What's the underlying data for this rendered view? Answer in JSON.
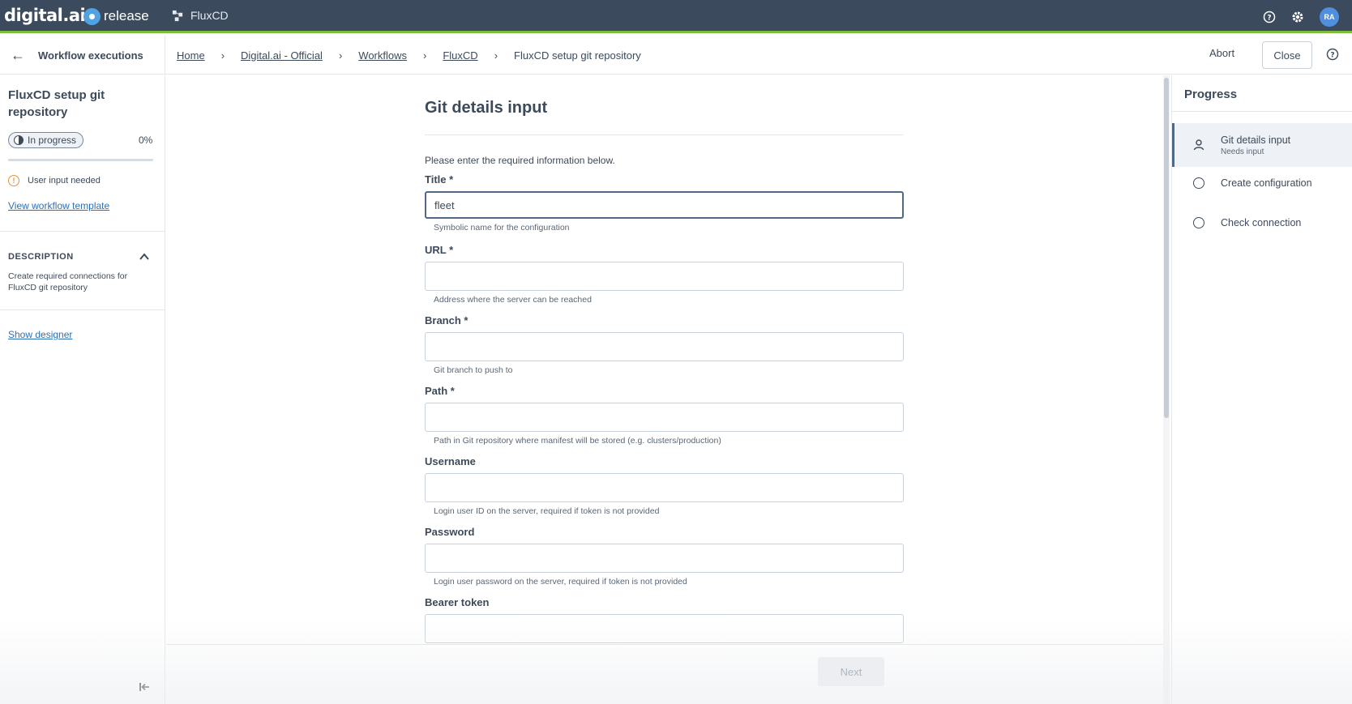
{
  "topbar": {
    "brand": "digital.ai",
    "product": "release",
    "app_name": "FluxCD",
    "avatar_initials": "RA",
    "colors": {
      "bar": "#3b4a5c",
      "accent_line": "#7ebd3a",
      "avatar": "#4f8fde"
    }
  },
  "nav": {
    "back_label": "Workflow executions",
    "breadcrumbs": [
      "Home",
      "Digital.ai - Official",
      "Workflows",
      "FluxCD"
    ],
    "current": "FluxCD setup git repository",
    "abort_label": "Abort",
    "close_label": "Close"
  },
  "sidebar": {
    "title": "FluxCD setup git repository",
    "status": "In progress",
    "percent": "0%",
    "progress_fraction": 0.0,
    "alert": "User input needed",
    "template_link": "View workflow template",
    "description_heading": "DESCRIPTION",
    "description": "Create required connections for FluxCD git repository",
    "designer_link": "Show designer"
  },
  "form": {
    "title": "Git details input",
    "intro": "Please enter the required information below.",
    "fields": [
      {
        "label": "Title *",
        "value": "fleet",
        "help": "Symbolic name for the configuration"
      },
      {
        "label": "URL *",
        "value": "",
        "help": "Address where the server can be reached"
      },
      {
        "label": "Branch *",
        "value": "",
        "help": "Git branch to push to"
      },
      {
        "label": "Path *",
        "value": "",
        "help": "Path in Git repository where manifest will be stored (e.g. clusters/production)"
      },
      {
        "label": "Username",
        "value": "",
        "help": "Login user ID on the server, required if token is not provided"
      },
      {
        "label": "Password",
        "value": "",
        "help": "Login user password on the server, required if token is not provided"
      },
      {
        "label": "Bearer token",
        "value": "",
        "help": ""
      }
    ],
    "next_label": "Next"
  },
  "progress_panel": {
    "heading": "Progress",
    "steps": [
      {
        "name": "Git details input",
        "sub": "Needs input",
        "icon": "user-icon"
      },
      {
        "name": "Create configuration",
        "sub": "",
        "icon": "circle-icon"
      },
      {
        "name": "Check connection",
        "sub": "",
        "icon": "circle-icon"
      }
    ]
  }
}
